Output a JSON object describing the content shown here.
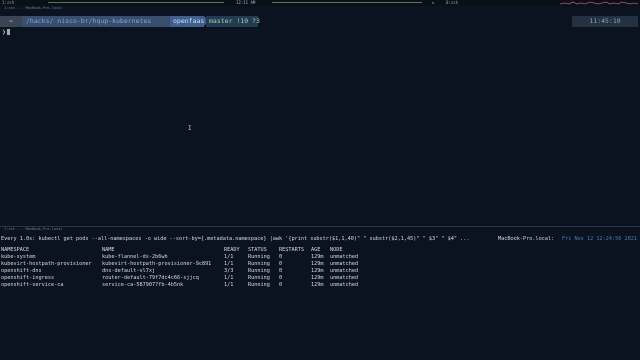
{
  "topbar": {
    "left_label": "1:zsh",
    "center_clock": "12:11 AM",
    "right_label": "0:zsh",
    "icon": "network-icon"
  },
  "pane_top": {
    "title": "1:zsh ... MacBook-Pro.local",
    "prompt": {
      "home": "~",
      "path": "/hacks/ nisco-br/hqup-kubernetes",
      "dir": "openfaas",
      "git": "master !10 ?3",
      "time": "11:45:10"
    },
    "cursor_prefix": "❯"
  },
  "pane_bottom": {
    "title": "1:zsh ... MacBook-Pro.local",
    "watch": {
      "command": "Every 1.0s: kubectl get pods --all-namespaces -o wide --sort-by={.metadata.namespace} |awk '{print substr($1,1,40)\" \" substr($2,1,45)\" \" $3\" \" $4\" ...",
      "host": "MacBook-Pro.local:",
      "datetime": "Fri Nov 12 12:24:56 2021"
    },
    "table": {
      "headers": [
        "NAMESPACE",
        "NAME",
        "READY",
        "STATUS",
        "RESTARTS",
        "AGE",
        "NODE"
      ],
      "rows": [
        [
          "kube-system",
          "kube-flannel-ds-2b6wh",
          "1/1",
          "Running",
          "0",
          "129m",
          "unmatched"
        ],
        [
          "kubevirt-hostpath-provisioner",
          "kubevirt-hostpath-provisioner-9c891",
          "1/1",
          "Running",
          "0",
          "129m",
          "unmatched"
        ],
        [
          "openshift-dns",
          "dns-default-vl7xj",
          "3/3",
          "Running",
          "0",
          "129m",
          "unmatched"
        ],
        [
          "openshift-ingress",
          "router-default-79f7dc4c66-sjjcq",
          "1/1",
          "Running",
          "0",
          "129m",
          "unmatched"
        ],
        [
          "openshift-service-ca",
          "service-ca-5879077fb-4b5nk",
          "1/1",
          "Running",
          "0",
          "129m",
          "unmatched"
        ]
      ]
    }
  },
  "colors": {
    "background": "#0b1320",
    "prompt_path": "#394d6e",
    "prompt_dir": "#3f5f90",
    "git_text": "#9fd49c",
    "date_text": "#4e79b8"
  }
}
